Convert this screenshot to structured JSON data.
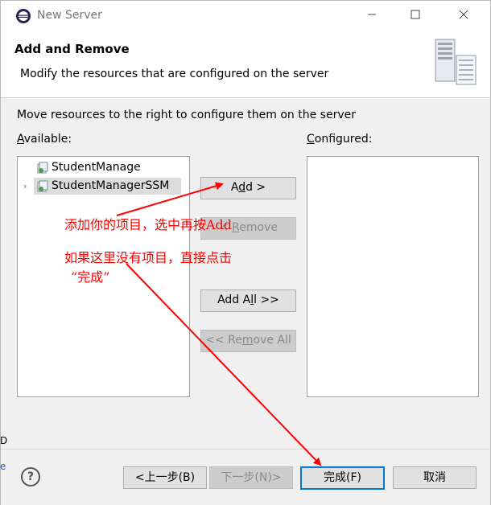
{
  "window": {
    "title": "New Server"
  },
  "header": {
    "title": "Add and Remove",
    "description": "Modify the resources that are configured on the server"
  },
  "body": {
    "instruction": "Move resources to the right to configure them on the server",
    "available_label_mnemonic": "A",
    "available_label_rest": "vailable:",
    "configured_label_mnemonic": "C",
    "configured_label_rest": "onfigured:",
    "available_items": [
      {
        "label": "StudentManage",
        "expandable": false,
        "selected": false
      },
      {
        "label": "StudentManagerSSM",
        "expandable": true,
        "selected": true
      }
    ],
    "configured_items": []
  },
  "side_buttons": {
    "add_pre": "A",
    "add_mn": "d",
    "add_post": "d >",
    "remove_pre": "< ",
    "remove_mn": "R",
    "remove_post": "emove",
    "addall_pre": "Add A",
    "addall_mn": "l",
    "addall_post": "l >>",
    "removeall_pre": "<< Re",
    "removeall_mn": "m",
    "removeall_post": "ove All"
  },
  "footer": {
    "help": "?",
    "back": "<上一步(B)",
    "next": "下一步(N)>",
    "finish": "完成(F)",
    "cancel": "取消"
  },
  "edge_fragments": {
    "frag1": "D",
    "frag2": "e"
  },
  "annotations": {
    "note1": "添加你的项目，选中再按Add",
    "note2_line1": "如果这里没有项目，直接点击",
    "note2_line2": "“完成”"
  },
  "colors": {
    "annotation": "#ff0000",
    "focus": "#0078d7"
  }
}
